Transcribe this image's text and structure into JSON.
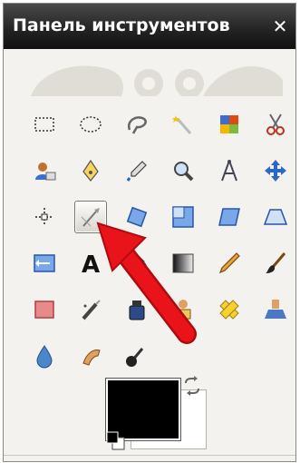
{
  "window": {
    "title": "Панель инструментов",
    "close_label": "✕"
  },
  "colors": {
    "titlebar": "#1c1c1c",
    "panel_bg": "#f3f2ee",
    "foreground": "#000000",
    "background": "#ffffff",
    "annotation_arrow": "#e8141a"
  },
  "tools": [
    {
      "name": "rect-select-icon",
      "row": 0,
      "col": 0
    },
    {
      "name": "ellipse-select-icon",
      "row": 0,
      "col": 1
    },
    {
      "name": "free-select-lasso-icon",
      "row": 0,
      "col": 2
    },
    {
      "name": "fuzzy-select-wand-icon",
      "row": 0,
      "col": 3
    },
    {
      "name": "select-by-color-icon",
      "row": 0,
      "col": 4
    },
    {
      "name": "scissors-select-icon",
      "row": 0,
      "col": 5
    },
    {
      "name": "foreground-select-icon",
      "row": 1,
      "col": 0
    },
    {
      "name": "paths-pen-icon",
      "row": 1,
      "col": 1
    },
    {
      "name": "color-picker-icon",
      "row": 1,
      "col": 2
    },
    {
      "name": "zoom-magnifier-icon",
      "row": 1,
      "col": 3
    },
    {
      "name": "measure-compass-icon",
      "row": 1,
      "col": 4
    },
    {
      "name": "move-arrows-icon",
      "row": 1,
      "col": 5
    },
    {
      "name": "align-icon",
      "row": 2,
      "col": 0
    },
    {
      "name": "crop-knife-icon",
      "row": 2,
      "col": 1,
      "active": true
    },
    {
      "name": "rotate-icon",
      "row": 2,
      "col": 2
    },
    {
      "name": "scale-icon",
      "row": 2,
      "col": 3
    },
    {
      "name": "shear-icon",
      "row": 2,
      "col": 4
    },
    {
      "name": "perspective-icon",
      "row": 2,
      "col": 5
    },
    {
      "name": "flip-icon",
      "row": 3,
      "col": 0
    },
    {
      "name": "text-icon",
      "row": 3,
      "col": 1
    },
    {
      "name": "bucket-fill-icon",
      "row": 3,
      "col": 2
    },
    {
      "name": "blend-gradient-icon",
      "row": 3,
      "col": 3
    },
    {
      "name": "pencil-icon",
      "row": 3,
      "col": 4
    },
    {
      "name": "paintbrush-icon",
      "row": 3,
      "col": 5
    },
    {
      "name": "eraser-icon",
      "row": 4,
      "col": 0
    },
    {
      "name": "airbrush-icon",
      "row": 4,
      "col": 1
    },
    {
      "name": "ink-bottle-icon",
      "row": 4,
      "col": 2
    },
    {
      "name": "clone-stamp-icon",
      "row": 4,
      "col": 3
    },
    {
      "name": "heal-bandage-icon",
      "row": 4,
      "col": 4
    },
    {
      "name": "perspective-clone-icon",
      "row": 4,
      "col": 5
    },
    {
      "name": "blur-drop-icon",
      "row": 5,
      "col": 0
    },
    {
      "name": "smudge-finger-icon",
      "row": 5,
      "col": 1
    },
    {
      "name": "dodge-burn-icon",
      "row": 5,
      "col": 2
    }
  ]
}
